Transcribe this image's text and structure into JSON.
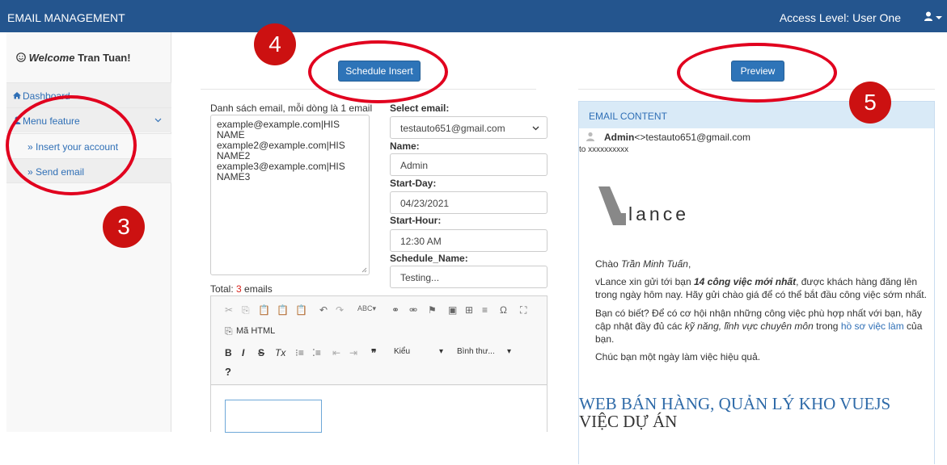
{
  "topbar": {
    "title": "EMAIL MANAGEMENT",
    "access_level": "Access Level: User One",
    "user_icon": "user-icon"
  },
  "sidebar": {
    "welcome_label": "Welcome",
    "welcome_name": "Tran Tuan!",
    "items": [
      {
        "label": "Dashboard",
        "icon": "home-icon"
      },
      {
        "label": "Menu feature",
        "icon": "user-icon"
      },
      {
        "label": "» Insert your account"
      },
      {
        "label": "» Send email"
      }
    ]
  },
  "actions": {
    "schedule_insert": "Schedule Insert",
    "preview": "Preview"
  },
  "form": {
    "email_list_label": "Danh sách email, mỗi dòng là 1 email",
    "email_list_lines": [
      "example@example.com|HIS",
      "NAME",
      "example2@example.com|HIS",
      "NAME2",
      "example3@example.com|HIS",
      "NAME3"
    ],
    "total_label": "Total: ",
    "total_count": "3",
    "total_suffix": " emails",
    "select_email_label": "Select email:",
    "select_email_value": "testauto651@gmail.com",
    "name_label": "Name:",
    "name_value": "Admin",
    "start_day_label": "Start-Day:",
    "start_day_value": "04/23/2021",
    "start_hour_label": "Start-Hour:",
    "start_hour_value": "12:30 AM",
    "schedule_name_label": "Schedule_Name:",
    "schedule_name_value": "Testing..."
  },
  "editor": {
    "source_label": "Mã HTML",
    "style_label": "Kiểu",
    "format_label": "Bình thư..."
  },
  "email_preview": {
    "header": "EMAIL CONTENT",
    "sender": "Admin",
    "recipient": "<>testauto651@gmail.com",
    "to_line": "to xxxxxxxxxx",
    "logo_text": "lance",
    "greeting_prefix": "Chào ",
    "greeting_name": "Trần Minh Tuấn",
    "greeting_suffix": ",",
    "intro_prefix": "vLance xin gửi tới bạn ",
    "intro_bold": "14 công việc mới nhất",
    "intro_suffix": ", được khách hàng đăng lên trong ngày hôm nay. Hãy gửi chào giá để có thể bắt đầu công việc sớm nhất.",
    "tip_prefix": "Bạn có biết? Để có cơ hội nhận những công việc phù hợp nhất với bạn, hãy cập nhật đầy đủ các ",
    "tip_italic": "kỹ năng, lĩnh vực chuyên môn",
    "tip_middle": " trong ",
    "tip_link": "hồ sơ việc làm",
    "tip_suffix": " của bạn.",
    "closing": "Chúc bạn một ngày làm việc hiệu quả.",
    "job_title_blue": "WEB BÁN HÀNG, QUẢN LÝ KHO VUEJS",
    "job_title_dark": " VIỆC DỰ ÁN"
  },
  "annotations": {
    "marker_3": "3",
    "marker_4": "4",
    "marker_5": "5"
  },
  "colors": {
    "topbar": "#24558e",
    "primary": "#2e74b8",
    "annotation_red": "#cc1111"
  }
}
